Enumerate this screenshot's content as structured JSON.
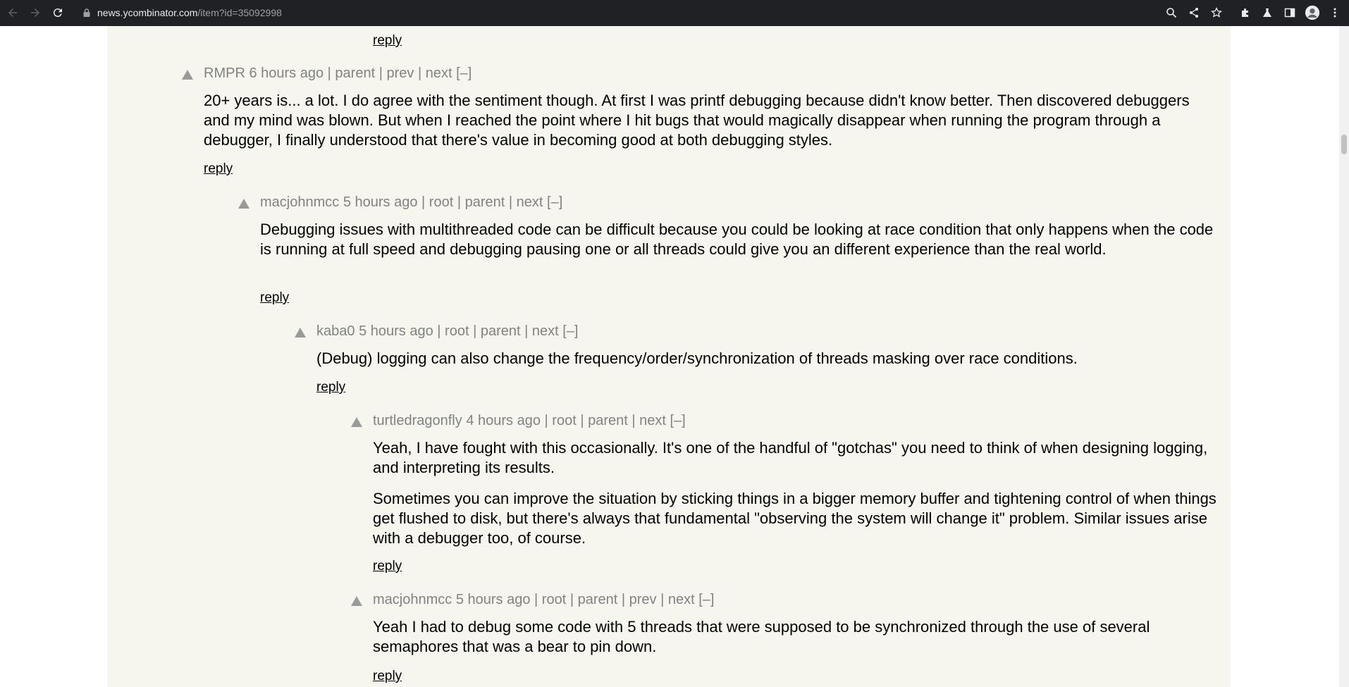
{
  "browser": {
    "url_host": "news.ycombinator.com",
    "url_path": "/item?id=35092998"
  },
  "separator": "|",
  "collapse": "[–]",
  "labels": {
    "root": "root",
    "parent": "parent",
    "prev": "prev",
    "next": "next",
    "reply": "reply"
  },
  "comments": [
    {
      "user": "RMPR",
      "age": "6 hours ago",
      "text": [
        "20+ years is... a lot. I do agree with the sentiment though. At first I was printf debugging because didn't know better. Then discovered debuggers and my mind was blown. But when I reached the point where I hit bugs that would magically disappear when running the program through a debugger, I finally understood that there's value in becoming good at both debugging styles."
      ]
    },
    {
      "user": "macjohnmcc",
      "age": "5 hours ago",
      "text": [
        "Debugging issues with multithreaded code can be difficult because you could be looking at race condition that only happens when the code is running at full speed and debugging pausing one or all threads could give you an different experience than the real world."
      ]
    },
    {
      "user": "kaba0",
      "age": "5 hours ago",
      "text": [
        "(Debug) logging can also change the frequency/order/synchronization of threads masking over race conditions."
      ]
    },
    {
      "user": "turtledragonfly",
      "age": "4 hours ago",
      "text": [
        "Yeah, I have fought with this occasionally. It's one of the handful of \"gotchas\" you need to think of when designing logging, and interpreting its results.",
        "Sometimes you can improve the situation by sticking things in a bigger memory buffer and tightening control of when things get flushed to disk, but there's always that fundamental \"observing the system will change it\" problem. Similar issues arise with a debugger too, of course."
      ]
    },
    {
      "user": "macjohnmcc",
      "age": "5 hours ago",
      "text": [
        "Yeah I had to debug some code with 5 threads that were supposed to be synchronized through the use of several semaphores that was a bear to pin down."
      ]
    }
  ]
}
